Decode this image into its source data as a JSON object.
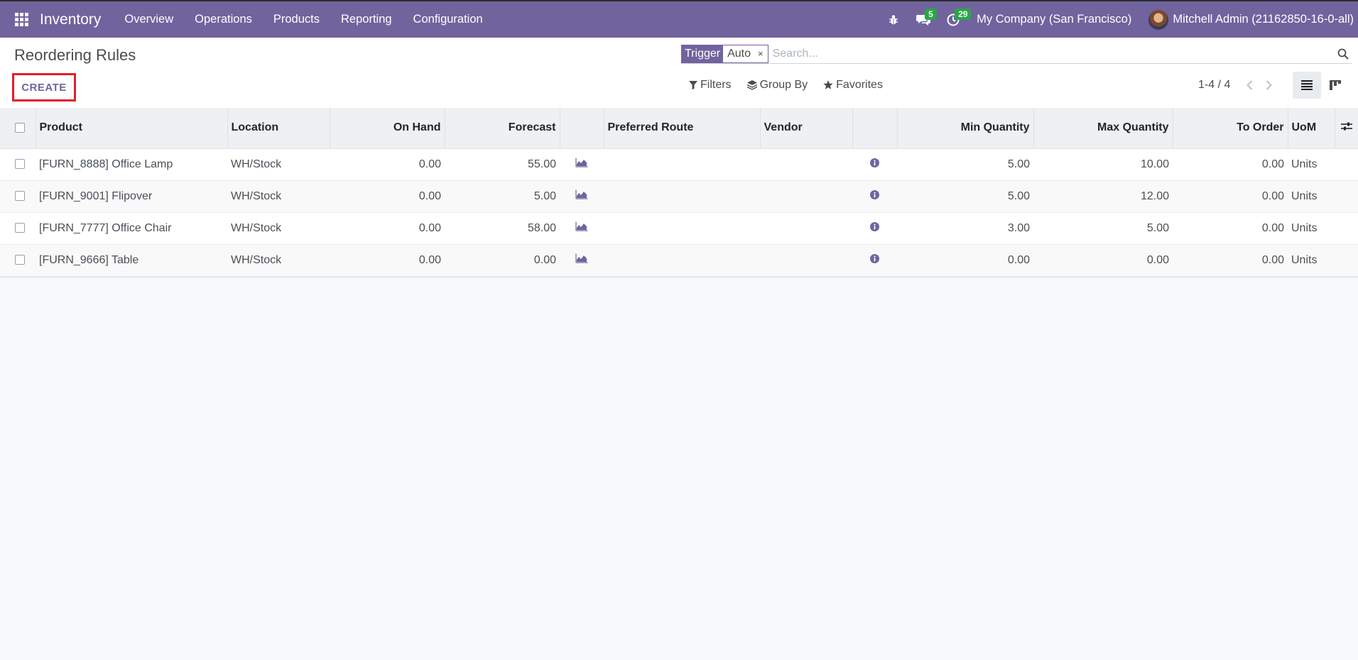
{
  "navbar": {
    "app_name": "Inventory",
    "menu": [
      "Overview",
      "Operations",
      "Products",
      "Reporting",
      "Configuration"
    ],
    "messages_badge": "5",
    "activities_badge": "29",
    "company": "My Company (San Francisco)",
    "user": "Mitchell Admin (21162850-16-0-all)"
  },
  "control_panel": {
    "title": "Reordering Rules",
    "create_label": "CREATE",
    "facet_label": "Trigger",
    "facet_value": "Auto",
    "facet_remove": "×",
    "search_placeholder": "Search...",
    "filters_label": "Filters",
    "group_by_label": "Group By",
    "favorites_label": "Favorites",
    "pager": "1-4 / 4"
  },
  "table": {
    "headers": {
      "product": "Product",
      "location": "Location",
      "on_hand": "On Hand",
      "forecast": "Forecast",
      "preferred_route": "Preferred Route",
      "vendor": "Vendor",
      "min_qty": "Min Quantity",
      "max_qty": "Max Quantity",
      "to_order": "To Order",
      "uom": "UoM"
    },
    "rows": [
      {
        "product": "[FURN_8888] Office Lamp",
        "location": "WH/Stock",
        "on_hand": "0.00",
        "forecast": "55.00",
        "min_qty": "5.00",
        "max_qty": "10.00",
        "to_order": "0.00",
        "uom": "Units"
      },
      {
        "product": "[FURN_9001] Flipover",
        "location": "WH/Stock",
        "on_hand": "0.00",
        "forecast": "5.00",
        "min_qty": "5.00",
        "max_qty": "12.00",
        "to_order": "0.00",
        "uom": "Units"
      },
      {
        "product": "[FURN_7777] Office Chair",
        "location": "WH/Stock",
        "on_hand": "0.00",
        "forecast": "58.00",
        "min_qty": "3.00",
        "max_qty": "5.00",
        "to_order": "0.00",
        "uom": "Units"
      },
      {
        "product": "[FURN_9666] Table",
        "location": "WH/Stock",
        "on_hand": "0.00",
        "forecast": "0.00",
        "min_qty": "0.00",
        "max_qty": "0.00",
        "to_order": "0.00",
        "uom": "Units"
      }
    ]
  },
  "colors": {
    "brand": "#71639e",
    "highlight": "#e11d2b",
    "badge": "#28a745"
  }
}
